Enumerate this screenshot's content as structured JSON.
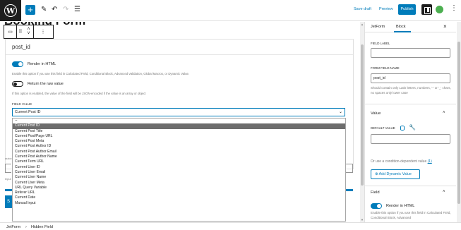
{
  "topbar": {
    "logo_letter": "W",
    "add_label": "+",
    "save_draft": "Save draft",
    "preview": "Preview",
    "publish": "Publish"
  },
  "canvas": {
    "page_title": "Booking Form",
    "field_title": "post_id",
    "render_html_label": "Render in HTML",
    "render_html_help": "Enable this option if you use this field in Calculated Field, Conditional Block, Advanced Validation, Global Macros, or Dynamic Value.",
    "raw_value_label": "Return the raw value",
    "raw_value_help": "If this option is enabled, the value of the field will be JSON-encoded if the value is an array or object",
    "field_value_label": "FIELD VALUE",
    "field_value_selected": "Current Post ID",
    "bg_frag_1": "autoc",
    "bg_frag_2": "Input",
    "bg_button_letter": "S"
  },
  "dropdown": {
    "options": [
      "--",
      "Current Post ID",
      "Current Post Title",
      "Current Post/Page URL",
      "Current Post Meta",
      "Current Post Author ID",
      "Current Post Author Email",
      "Current Post Author Name",
      "Current Term URL",
      "Current User ID",
      "Current User Email",
      "Current User Name",
      "Current User Meta",
      "URL Query Variable",
      "Referer URL",
      "Current Date",
      "Manual Input"
    ],
    "selected_index": 1
  },
  "sidebar": {
    "tab_jetform": "JetForm",
    "tab_block": "Block",
    "close_glyph": "×",
    "field_label_label": "FIELD LABEL",
    "field_label_value": "",
    "form_field_name_label": "FORM FIELD NAME",
    "form_field_name_value": "post_id",
    "name_help": "Should contain only Latin letters, numbers, '-' or '_' chars, no spaces only lower case",
    "value_section": "Value",
    "default_value_label": "DEFAULT VALUE",
    "default_value": "",
    "condition_text": "Or use a condition-dependent value",
    "condition_count": "(1)",
    "add_dynamic_value": "Add Dynamic Value",
    "field_section": "Field",
    "sb_render_html": "Render in HTML",
    "sb_render_help": "Enable this option if you use this field in Calculated Field, Conditional Block, Advanced"
  },
  "footer": {
    "crumb_1": "JetForm",
    "separator": "›",
    "crumb_2": "Hidden Field"
  },
  "colors": {
    "accent": "#007cba",
    "dark": "#1e1e1e",
    "selected_option_bg": "#6d6d6d"
  },
  "icons": [
    "wordpress-logo-icon",
    "plus-icon",
    "pencil-icon",
    "undo-icon",
    "redo-icon",
    "list-view-icon",
    "settings-panel-icon",
    "plugin-icon",
    "more-vertical-icon",
    "drag-handle-icon",
    "move-arrows-icon",
    "database-icon",
    "wrench-icon",
    "plus-circle-icon",
    "chevron-up-icon",
    "chevron-down-icon",
    "close-icon"
  ]
}
